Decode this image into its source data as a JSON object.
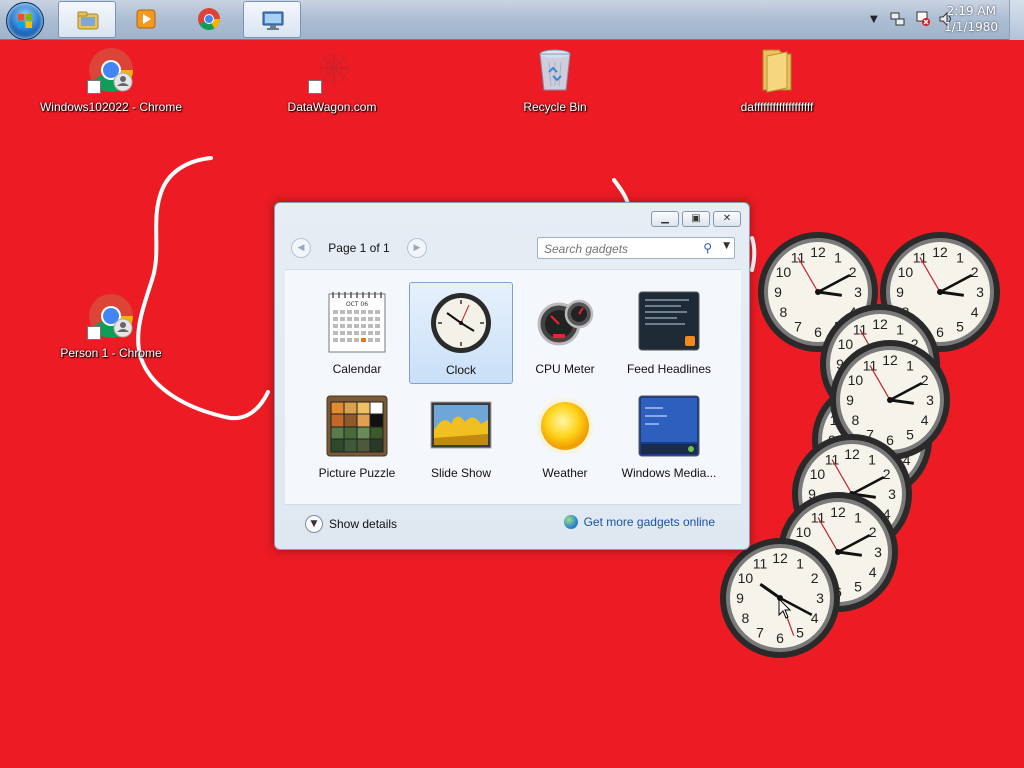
{
  "taskbar": {
    "buttons": [
      {
        "name": "file-explorer",
        "active": true
      },
      {
        "name": "media-player",
        "active": false
      },
      {
        "name": "chrome",
        "active": false
      },
      {
        "name": "remote-desktop",
        "active": true
      }
    ],
    "clock": {
      "time": "2:19 AM",
      "date": "1/1/1980"
    }
  },
  "desktop": {
    "background_color": "#ec1b24",
    "icons": [
      {
        "label": "Windows102022 - Chrome"
      },
      {
        "label": "DataWagon.com"
      },
      {
        "label": "Recycle Bin"
      },
      {
        "label": "dafffffffffffffffffff"
      },
      {
        "label": "Person 1 - Chrome"
      }
    ]
  },
  "gadgets_dialog": {
    "page_label": "Page 1 of 1",
    "search_placeholder": "Search gadgets",
    "gadgets": [
      {
        "label": "Calendar"
      },
      {
        "label": "Clock"
      },
      {
        "label": "CPU Meter"
      },
      {
        "label": "Feed Headlines"
      },
      {
        "label": "Picture Puzzle"
      },
      {
        "label": "Slide Show"
      },
      {
        "label": "Weather"
      },
      {
        "label": "Windows Media..."
      }
    ],
    "selected_gadget": "Clock",
    "show_details_label": "Show details",
    "get_more_label": "Get more gadgets online",
    "calendar_month": "OCT 06"
  }
}
